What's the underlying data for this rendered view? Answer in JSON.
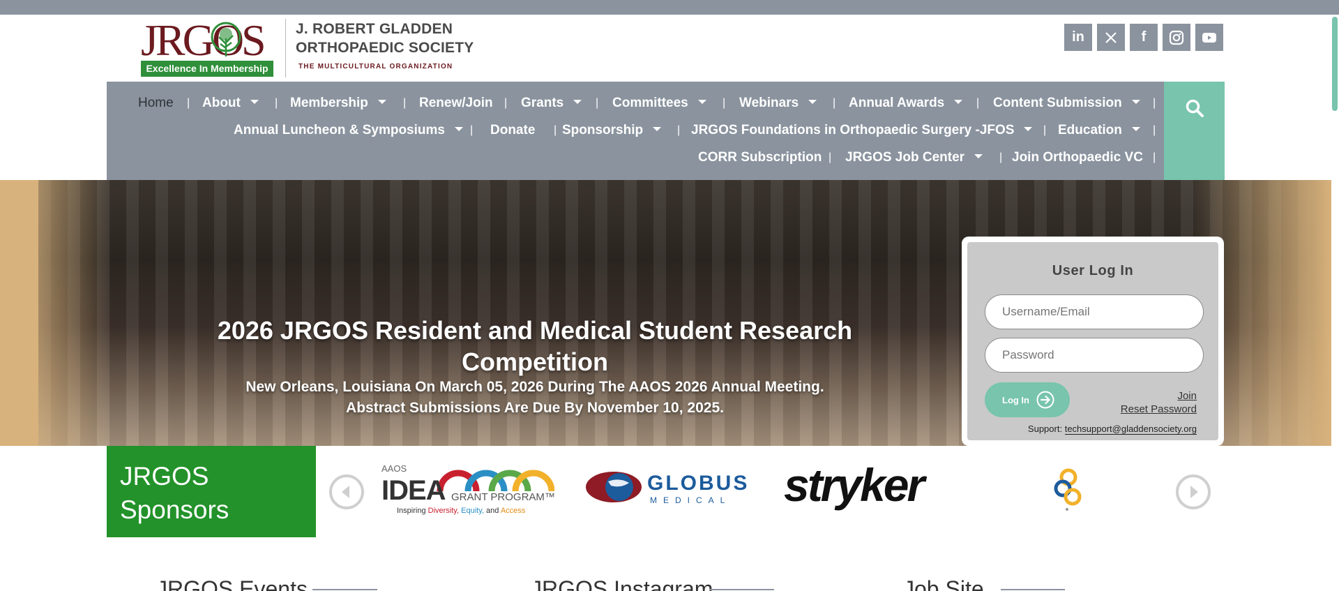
{
  "header": {
    "logo_word": "JRGOS",
    "logo_tagline": "Excellence In Membership",
    "org_line1": "J. ROBERT GLADDEN",
    "org_line2": "ORTHOPAEDIC SOCIETY",
    "org_subtitle": "THE MULTICULTURAL ORGANIZATION",
    "social": [
      {
        "icon": "linkedin-icon",
        "glyph": "in"
      },
      {
        "icon": "x-twitter-icon",
        "glyph": "𝕏"
      },
      {
        "icon": "facebook-icon",
        "glyph": "f"
      },
      {
        "icon": "instagram-icon",
        "glyph": ""
      },
      {
        "icon": "youtube-icon",
        "glyph": ""
      }
    ]
  },
  "nav": {
    "row1": [
      "Home",
      "About",
      "Membership",
      "Renew/Join",
      "Grants",
      "Committees",
      "Webinars",
      "Annual Awards",
      "Content Submission"
    ],
    "row2": [
      "Annual Luncheon & Symposiums",
      "Donate",
      "Sponsorship",
      "JRGOS Foundations in Orthopaedic Surgery -JFOS",
      "Education"
    ],
    "row3": [
      "CORR Subscription",
      "JRGOS Job Center",
      "Join Orthopaedic VC"
    ],
    "active": "Home",
    "separator": "|"
  },
  "hero": {
    "title_line1": "2026 JRGOS Resident and Medical Student Research",
    "title_line2": "Competition",
    "sub_line1": "New Orleans, Louisiana On March 05, 2026 During The AAOS 2026 Annual Meeting.",
    "sub_line2": "Abstract Submissions Are Due By November 10, 2025."
  },
  "login": {
    "title": "User Log In",
    "username_placeholder": "Username/Email",
    "password_placeholder": "Password",
    "button_label": "Log In",
    "join_link": "Join",
    "reset_link": "Reset Password",
    "support_label": "Support:",
    "support_email": "techsupport@gladdensociety.org"
  },
  "sponsors": {
    "title_line1": "JRGOS",
    "title_line2": "Sponsors",
    "logos": {
      "aaos_small": "AAOS",
      "idea_main": "IDEA",
      "idea_program": "GRANT PROGRAM™",
      "idea_tag_prefix": "Inspiring",
      "idea_tag_diversity": "Diversity,",
      "idea_tag_equity": "Equity,",
      "idea_tag_and": "and",
      "idea_tag_access": "Access",
      "globus_line1": "GLOBUS",
      "globus_line2": "MEDICAL",
      "stryker": "stryker"
    }
  },
  "sections": {
    "events": "JRGOS Events",
    "instagram": "JRGOS Instagram",
    "jobs": "Job Site"
  },
  "colors": {
    "nav_gray": "#8a939e",
    "accent_teal": "#78c4ad",
    "brand_green": "#23922a",
    "brand_maroon": "#6b1a1f"
  }
}
